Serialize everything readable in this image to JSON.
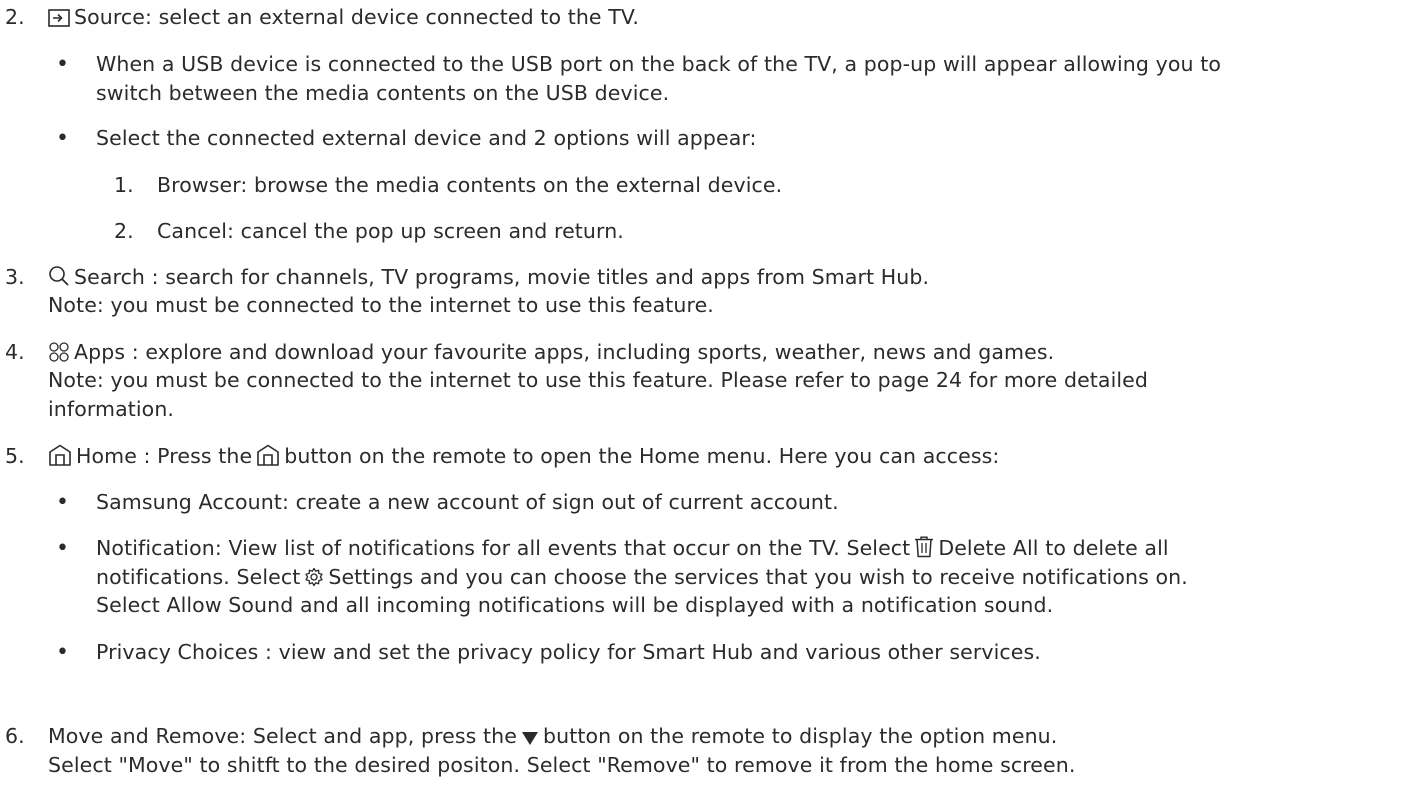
{
  "items": {
    "i2": {
      "number": "2.",
      "label": "Source: select an external device connected to the TV.",
      "bullet1_line1": "When a USB device is connected to the USB port on the back of the TV, a pop-up will appear allowing you to",
      "bullet1_line2": "switch between the media contents on the USB device.",
      "bullet2": "Select the connected external device and 2 options will appear:",
      "sub1_number": "1.",
      "sub1": "Browser: browse the media contents on the external device.",
      "sub2_number": "2.",
      "sub2": "Cancel: cancel the pop up screen and return."
    },
    "i3": {
      "number": "3.",
      "line1": "Search : search for channels, TV programs, movie titles and apps from Smart Hub.",
      "line2": "Note: you must be connected to the internet to use this feature."
    },
    "i4": {
      "number": "4.",
      "line1": "Apps : explore and download your favourite apps, including sports, weather, news and games.",
      "line2": "Note: you must be connected to the internet to use this feature. Please refer to page 24 for more detailed",
      "line3": "information."
    },
    "i5": {
      "number": "5.",
      "line1_a": "Home : Press the",
      "line1_b": "button on the remote to open the Home menu. Here you can access:",
      "bullet1": "Samsung Account: create a new account of sign out of current account.",
      "bullet2_line1_a": "Notification: View list of notifications for all events that occur on the TV. Select",
      "bullet2_line1_b": "Delete All to delete all",
      "bullet2_line2_a": "notifications. Select",
      "bullet2_line2_b": "Settings and you can choose the services that you wish to receive notifications on.",
      "bullet2_line3": "Select Allow Sound and all incoming notifications will be displayed with a notification sound.",
      "bullet3": "Privacy Choices : view and set the privacy policy for Smart Hub and various other services."
    },
    "i6": {
      "number": "6.",
      "line1_a": "Move and Remove: Select and app, press the",
      "line1_b": "button on the remote to display the option menu.",
      "line2": "Select \"Move\" to shitft to the desired positon. Select \"Remove\" to remove it from the home screen."
    }
  },
  "icons": {
    "source": "source-input-icon",
    "search": "search-icon",
    "apps": "apps-grid-icon",
    "home": "home-icon",
    "trash": "trash-icon",
    "settings": "gear-icon",
    "down": "down-triangle-icon"
  },
  "colors": {
    "text": "#2b2b2b"
  }
}
